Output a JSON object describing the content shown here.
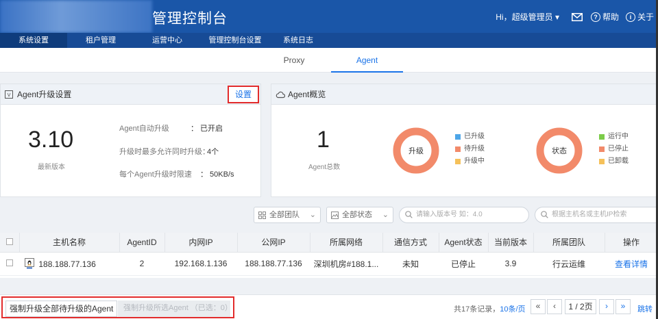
{
  "header": {
    "title": "管理控制台",
    "greeting": "Hi，超级管理员",
    "help": "帮助",
    "about": "关于"
  },
  "nav": {
    "items": [
      {
        "label": "系统设置"
      },
      {
        "label": "租户管理"
      },
      {
        "label": "运营中心"
      },
      {
        "label": "管理控制台设置"
      },
      {
        "label": "系统日志"
      }
    ]
  },
  "subtabs": [
    {
      "label": "Proxy"
    },
    {
      "label": "Agent"
    }
  ],
  "upgrade_panel": {
    "title": "Agent升级设置",
    "settings_button": "设置",
    "latest_version": "3.10",
    "latest_version_label": "最新版本",
    "auto_upgrade_label": "Agent自动升级",
    "auto_upgrade_value": "：  已开启",
    "max_concurrent_label": "升级时最多允许同时升级：",
    "max_concurrent_value": "4个",
    "rate_limit_label": "每个Agent升级时限速",
    "rate_limit_value": "：  50KB/s"
  },
  "overview_panel": {
    "title": "Agent概览",
    "agent_total": "1",
    "agent_total_label": "Agent总数",
    "upgrade_donut": {
      "center_label": "升级",
      "legend": [
        {
          "label": "已升级",
          "color": "#4da6e8"
        },
        {
          "label": "待升级",
          "color": "#f28a6a"
        },
        {
          "label": "升级中",
          "color": "#f5c15a"
        }
      ],
      "ring_color": "#f28a6a"
    },
    "status_donut": {
      "center_label": "状态",
      "legend": [
        {
          "label": "运行中",
          "color": "#7ccc4a"
        },
        {
          "label": "已停止",
          "color": "#f28a6a"
        },
        {
          "label": "已卸载",
          "color": "#f5c15a"
        }
      ],
      "ring_color": "#f28a6a"
    }
  },
  "filters": {
    "team": "全部团队",
    "status": "全部状态",
    "version_placeholder": "请输入版本号 如：4.0",
    "host_placeholder": "根据主机名或主机IP检索"
  },
  "table": {
    "headers": [
      "主机名称",
      "AgentID",
      "内网IP",
      "公网IP",
      "所属网络",
      "通信方式",
      "Agent状态",
      "当前版本",
      "所属团队",
      "操作"
    ],
    "rows": [
      {
        "hostname": "188.188.77.136",
        "agent_id": "2",
        "intranet_ip": "192.168.1.136",
        "public_ip": "188.188.77.136",
        "network": "深圳机房#188.1...",
        "comm_mode": "未知",
        "agent_status": "已停止",
        "version": "3.9",
        "team": "行云运维",
        "action": "查看详情"
      }
    ]
  },
  "footer": {
    "force_all": "强制升级全部待升级的Agent",
    "force_selected": "强制升级所选Agent （已选：0）",
    "total": "共17条记录，",
    "per_page": "10条/页",
    "page": "1 / 2页",
    "jump": "跳转"
  }
}
